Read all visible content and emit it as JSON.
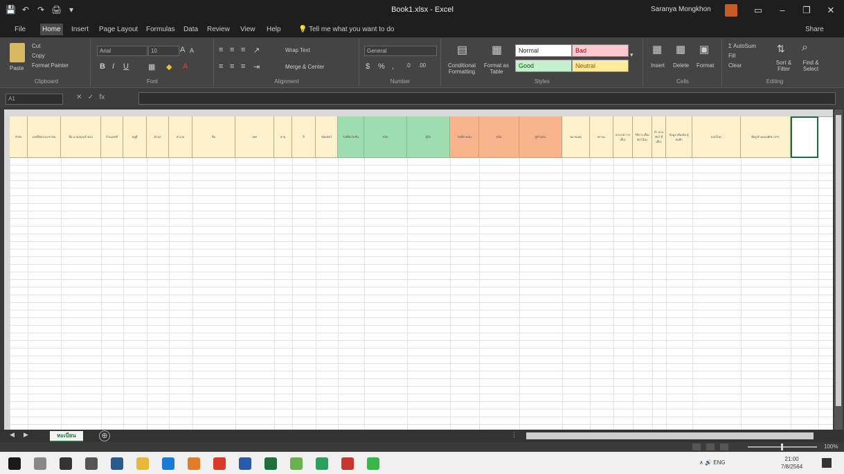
{
  "window": {
    "title": "Book1.xlsx - Excel",
    "user": "Saranya Mongkhon",
    "minimize": "–",
    "maximize": "❐",
    "close": "✕"
  },
  "qat": [
    "💾",
    "↶",
    "↷",
    "🖨",
    "▾"
  ],
  "tabs": [
    {
      "label": "File"
    },
    {
      "label": "Home",
      "active": true
    },
    {
      "label": "Insert"
    },
    {
      "label": "Page Layout"
    },
    {
      "label": "Formulas"
    },
    {
      "label": "Data"
    },
    {
      "label": "Review"
    },
    {
      "label": "View"
    },
    {
      "label": "Help"
    },
    {
      "label": "Tell me what you want to do"
    }
  ],
  "share_label": "Share",
  "ribbon": {
    "clipboard": {
      "paste": "Paste",
      "cut": "Cut",
      "copy": "Copy",
      "format_painter": "Format Painter",
      "label": "Clipboard"
    },
    "font": {
      "name": "Arial",
      "size": "10",
      "label": "Font"
    },
    "alignment": {
      "wrap": "Wrap Text",
      "merge": "Merge & Center",
      "label": "Alignment"
    },
    "number": {
      "format": "General",
      "label": "Number"
    },
    "styles": {
      "conditional": "Conditional Formatting",
      "format_table": "Format as Table",
      "normal": "Normal",
      "bad": "Bad",
      "good": "Good",
      "neutral": "Neutral",
      "label": "Styles"
    },
    "cells": {
      "insert": "Insert",
      "delete": "Delete",
      "format": "Format",
      "label": "Cells"
    },
    "editing": {
      "autosum": "AutoSum",
      "fill": "Fill",
      "clear": "Clear",
      "sort": "Sort & Filter",
      "find": "Find & Select",
      "label": "Editing"
    }
  },
  "formula": {
    "namebox": "A1",
    "fx": "fx"
  },
  "header_cells": [
    {
      "label": "ลำดับ",
      "w": 26,
      "bg": "#fdf0cc"
    },
    {
      "label": "เลขที่บัตรประชาชน",
      "w": 48,
      "bg": "#fdf0cc"
    },
    {
      "label": "ชื่อ-นามสกุลเจ้าของ",
      "w": 58,
      "bg": "#fdf0cc"
    },
    {
      "label": "บ้านเลขที่",
      "w": 32,
      "bg": "#fdf0cc"
    },
    {
      "label": "หมู่ที่",
      "w": 34,
      "bg": "#fdf0cc"
    },
    {
      "label": "ตำบล",
      "w": 32,
      "bg": "#fdf0cc"
    },
    {
      "label": "อำเภอ",
      "w": 34,
      "bg": "#fdf0cc"
    },
    {
      "label": "ชื่อ",
      "w": 62,
      "bg": "#fdf0cc"
    },
    {
      "label": "เพศ",
      "w": 56,
      "bg": "#fdf0cc"
    },
    {
      "label": "อายุ",
      "w": 26,
      "bg": "#fdf0cc"
    },
    {
      "label": "สี",
      "w": 34,
      "bg": "#fdf0cc"
    },
    {
      "label": "ชนิดสัตว์",
      "w": 32,
      "bg": "#fdf0cc"
    },
    {
      "label": "วันที่ฉีดวัคซีน",
      "w": 38,
      "bg": "#9fdcae"
    },
    {
      "label": "ชนิด",
      "w": 62,
      "bg": "#9fdcae"
    },
    {
      "label": "ผู้ฉีด",
      "w": 62,
      "bg": "#9fdcae"
    },
    {
      "label": "วันที่ทำหมัน",
      "w": 42,
      "bg": "#f6b38c"
    },
    {
      "label": "ชนิด",
      "w": 58,
      "bg": "#f6b38c"
    },
    {
      "label": "ผู้ทำหมัน",
      "w": 62,
      "bg": "#f6b38c"
    },
    {
      "label": "หมายเหตุ",
      "w": 40,
      "bg": "#fdf0cc"
    },
    {
      "label": "สถานะ",
      "w": 34,
      "bg": "#fdf0cc"
    },
    {
      "label": "ประเภท การ เลี้ยง",
      "w": 28,
      "bg": "#fdf0cc"
    },
    {
      "label": "วิธีการ เลี้ยง สัตว์ อื่นๆ",
      "w": 28,
      "bg": "#fdf0cc"
    },
    {
      "label": "จำ นวน สัตว์ ที่ เลี้ยง",
      "w": 20,
      "bg": "#fdf0cc"
    },
    {
      "label": "ข้อมูล เพิ่มเติม ผู้บันทึก",
      "w": 38,
      "bg": "#fdf0cc"
    },
    {
      "label": "เบอร์โทร",
      "w": 70,
      "bg": "#fdf0cc"
    },
    {
      "label": "ที่อยู่ ตำแหน่งพิกัด GPS",
      "w": 72,
      "bg": "#fdf0cc"
    },
    {
      "label": "",
      "w": 40,
      "bg": "#ffffff"
    }
  ],
  "sheet": {
    "name": "ทะเบียน",
    "add": "⊕"
  },
  "status": {
    "zoom": "100%"
  },
  "taskbar": {
    "icons": [
      {
        "name": "windows-start-icon",
        "color": "#1a1a1a"
      },
      {
        "name": "search-icon",
        "color": "#888"
      },
      {
        "name": "cortana-icon",
        "color": "#333"
      },
      {
        "name": "task-view-icon",
        "color": "#555"
      },
      {
        "name": "store-icon",
        "color": "#2a5a8a"
      },
      {
        "name": "file-explorer-icon",
        "color": "#e8b83a"
      },
      {
        "name": "edge-icon",
        "color": "#1b7ad6"
      },
      {
        "name": "photos-icon",
        "color": "#e07b28"
      },
      {
        "name": "chrome-icon",
        "color": "#d83a2a"
      },
      {
        "name": "word-icon",
        "color": "#2b5aa8"
      },
      {
        "name": "excel-icon",
        "color": "#1e6e3c"
      },
      {
        "name": "app-green-icon",
        "color": "#6ab04c"
      },
      {
        "name": "chrome-alt-icon",
        "color": "#2e9e5e"
      },
      {
        "name": "pdf-icon",
        "color": "#c8372d"
      },
      {
        "name": "line-icon",
        "color": "#3ab54a"
      }
    ],
    "tray": "∧ 🔊 ENG",
    "time": "21:00",
    "date": "7/8/2564"
  }
}
